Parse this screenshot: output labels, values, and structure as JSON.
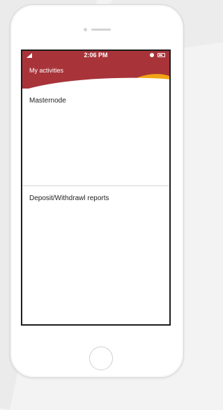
{
  "status_bar": {
    "time": "2:06 PM"
  },
  "header": {
    "title": "My activities"
  },
  "sections": [
    {
      "label": "Masternode"
    },
    {
      "label": "Deposit/Withdrawl reports"
    }
  ],
  "colors": {
    "header_bg": "#a8343a",
    "accent": "#f2a417"
  },
  "icons": {
    "signal": "signal-icon",
    "alarm": "alarm-icon",
    "battery": "battery-icon"
  }
}
